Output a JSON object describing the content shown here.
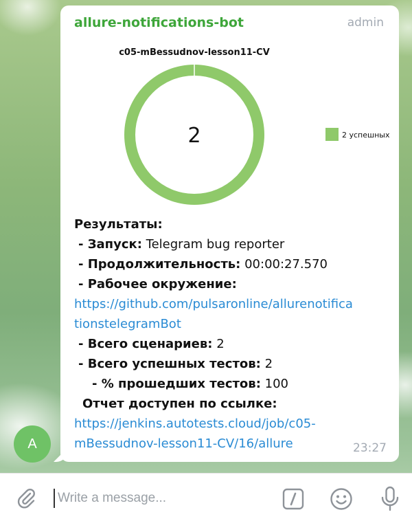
{
  "message": {
    "sender": "allure-notifications-bot",
    "role": "admin",
    "time": "23:27",
    "avatar_letter": "A"
  },
  "chart_data": {
    "type": "pie",
    "title": "c05-mBessudnov-lesson11-CV",
    "center_label": "2",
    "slices": [
      {
        "label": "2 успешных",
        "value": 2,
        "color": "#8fc96a"
      }
    ],
    "legend_position": "right"
  },
  "report": {
    "heading": "Результаты:",
    "launch_label": "- Запуск:",
    "launch_value": "Telegram bug reporter",
    "duration_label": "- Продолжительность:",
    "duration_value": "00:00:27.570",
    "env_label": "- Рабочее окружение:",
    "env_link_line1": "https://github.com/pulsaronline/allurenotifica",
    "env_link_line2": "tionstelegramBot",
    "total_label": "- Всего сценариев:",
    "total_value": "2",
    "passed_label": "- Всего успешных тестов:",
    "passed_value": "2",
    "percent_label": "- % прошедших тестов:",
    "percent_value": "100",
    "report_label": "Отчет доступен по ссылке:",
    "report_link_line1": "https://jenkins.autotests.cloud/job/c05-",
    "report_link_line2": "mBessudnov-lesson11-CV/16/allure"
  },
  "composer": {
    "placeholder": "Write a message...",
    "attach_icon": "paperclip-icon",
    "command_icon": "slash-command-icon",
    "emoji_icon": "smiley-icon",
    "mic_icon": "microphone-icon"
  }
}
